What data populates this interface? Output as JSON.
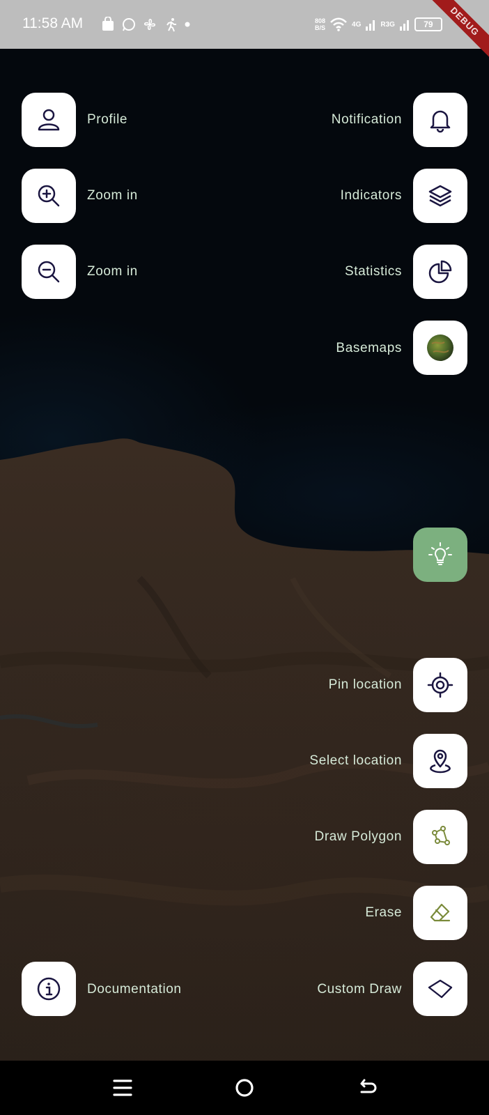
{
  "status_bar": {
    "time": "11:58 AM",
    "speed_value": "808",
    "speed_unit": "B/S",
    "net1": "4G",
    "net2": "R3G",
    "battery": "79",
    "debug_banner": "DEBUG"
  },
  "left_actions": [
    {
      "label": "Profile",
      "icon": "user-icon"
    },
    {
      "label": "Zoom in",
      "icon": "zoom-in-icon"
    },
    {
      "label": "Zoom in",
      "icon": "zoom-out-icon"
    }
  ],
  "right_actions": [
    {
      "label": "Notification",
      "icon": "bell-icon"
    },
    {
      "label": "Indicators",
      "icon": "layers-icon"
    },
    {
      "label": "Statistics",
      "icon": "pie-chart-icon"
    },
    {
      "label": "Basemaps",
      "icon": "globe-thumbnail-icon"
    }
  ],
  "lightbulb_button": {
    "icon": "lightbulb-icon",
    "color": "#7cb07f"
  },
  "draw_actions": [
    {
      "label": "Pin location",
      "icon": "crosshair-icon"
    },
    {
      "label": "Select location",
      "icon": "map-pin-icon"
    },
    {
      "label": "Draw Polygon",
      "icon": "polygon-icon"
    },
    {
      "label": "Erase",
      "icon": "eraser-icon"
    },
    {
      "label": "Custom Draw",
      "icon": "diamond-shape-icon"
    }
  ],
  "documentation": {
    "label": "Documentation",
    "icon": "info-icon"
  },
  "colors": {
    "icon_dark": "#1a1540",
    "label_text": "#d6ead8",
    "accent_green": "#7cb07f",
    "eraser_olive": "#7a8a3a"
  }
}
